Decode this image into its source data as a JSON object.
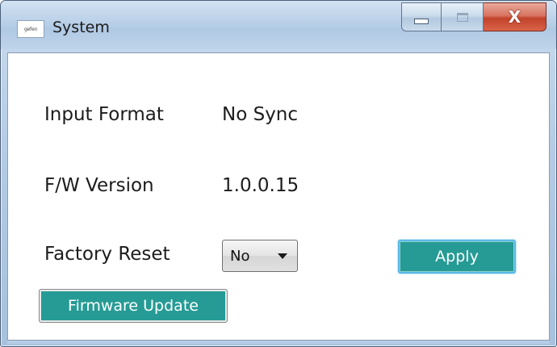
{
  "window": {
    "title": "System",
    "app_icon_text": "gefen",
    "caption_buttons": {
      "minimize_icon": "minimize-icon",
      "maximize_icon": "maximize-icon",
      "close_icon": "close-icon",
      "close_glyph": "X"
    }
  },
  "fields": {
    "input_format": {
      "label": "Input Format",
      "value": "No Sync"
    },
    "fw_version": {
      "label": "F/W Version",
      "value": "1.0.0.15"
    },
    "factory_reset": {
      "label": "Factory Reset",
      "selected": "No"
    }
  },
  "buttons": {
    "apply": "Apply",
    "firmware_update": "Firmware Update"
  },
  "colors": {
    "button_teal": "#269b95",
    "close_red": "#c2432a",
    "titlebar_blue": "#bcd2e9"
  }
}
